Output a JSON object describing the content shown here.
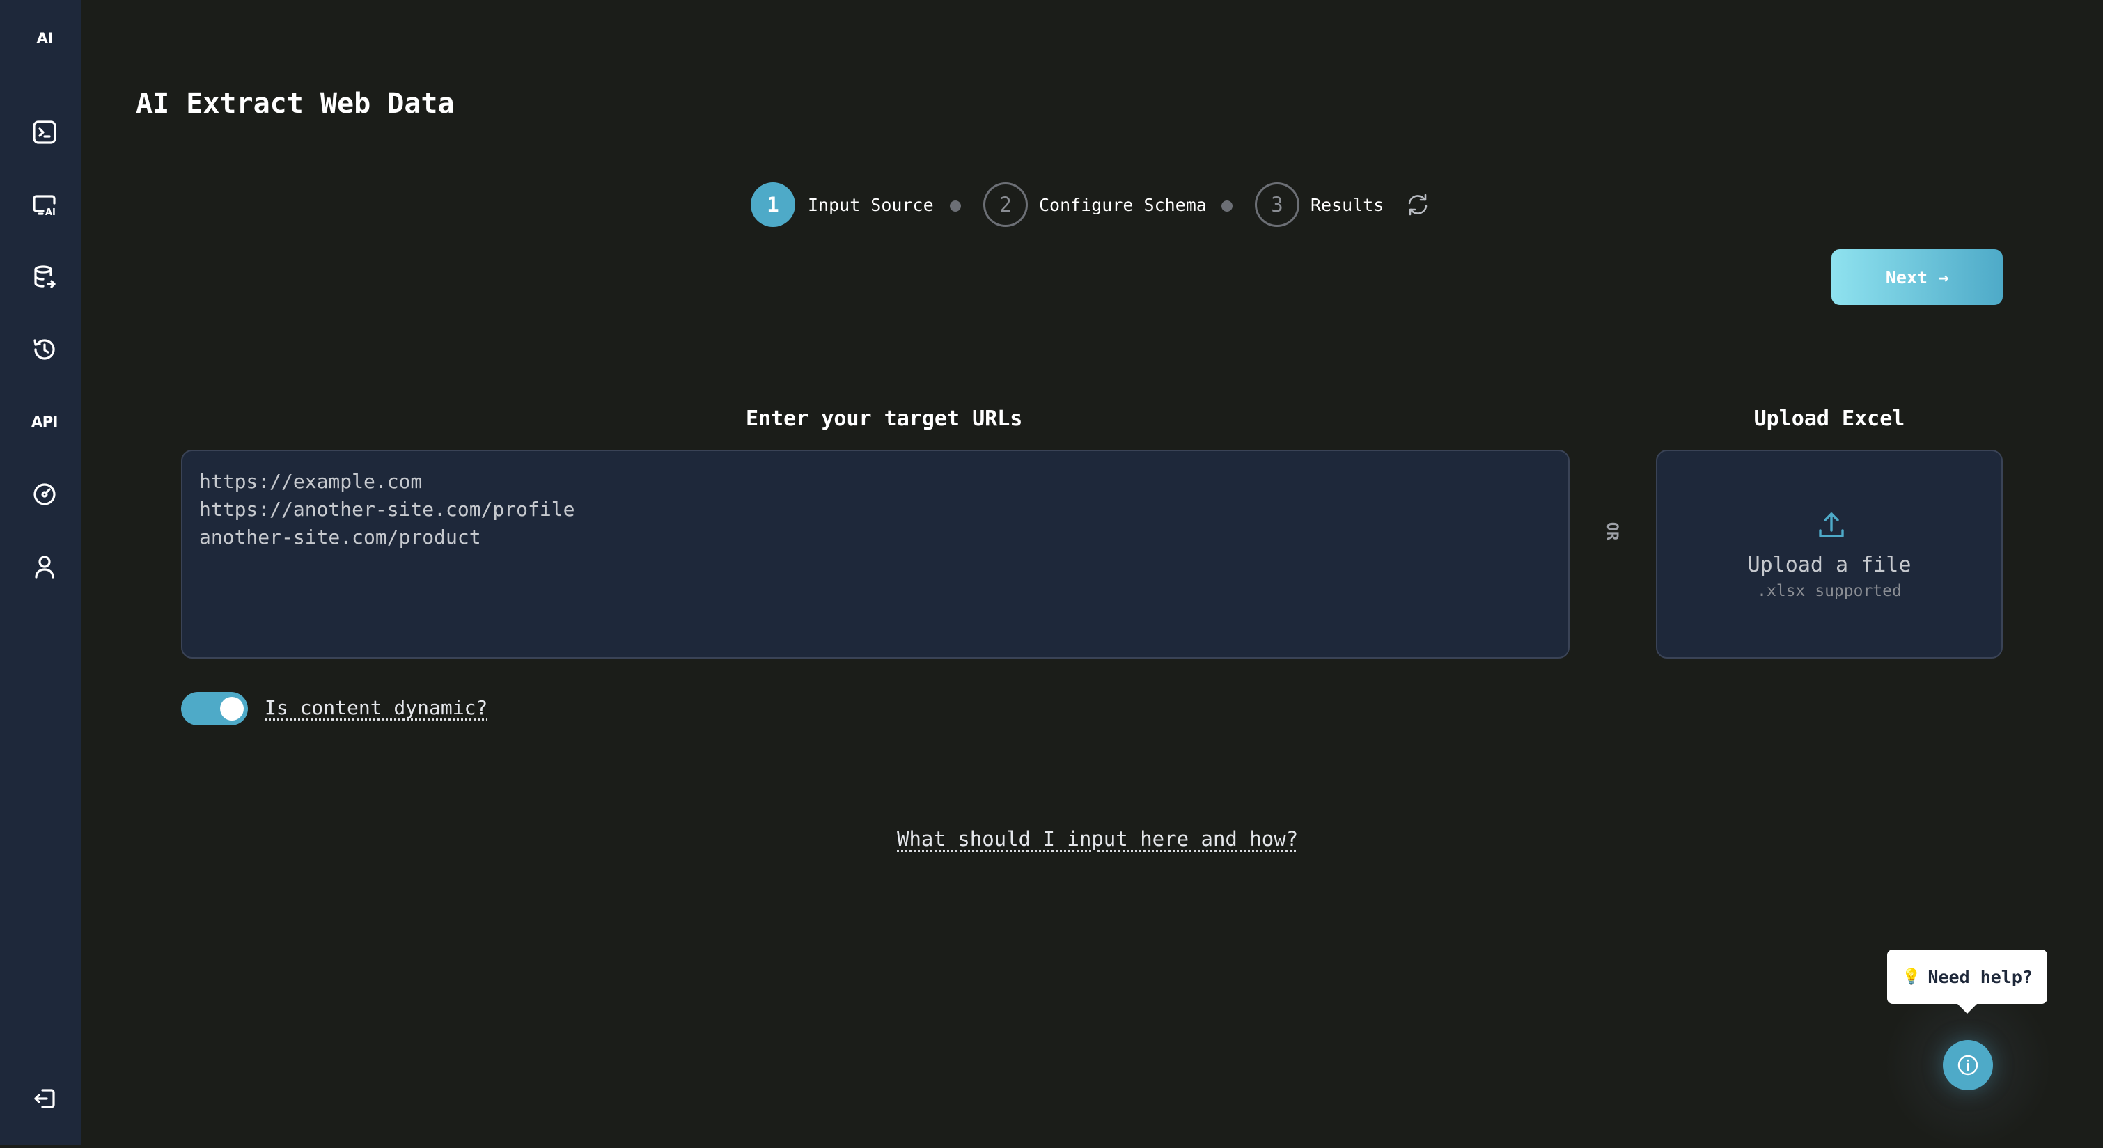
{
  "sidebar": {
    "logo_label": "AI",
    "api_label": "API",
    "items": [
      {
        "icon": "terminal-icon"
      },
      {
        "icon": "ai-screen-icon"
      },
      {
        "icon": "database-export-icon"
      },
      {
        "icon": "history-icon"
      },
      {
        "icon": "api-icon"
      },
      {
        "icon": "gauge-icon"
      },
      {
        "icon": "user-icon"
      }
    ],
    "logout_icon": "logout-icon"
  },
  "page": {
    "title": "AI Extract Web Data"
  },
  "stepper": {
    "steps": [
      {
        "number": "1",
        "label": "Input Source",
        "state": "active"
      },
      {
        "number": "2",
        "label": "Configure Schema",
        "state": "inactive"
      },
      {
        "number": "3",
        "label": "Results",
        "state": "inactive"
      }
    ],
    "reset_icon": "refresh-icon"
  },
  "toolbar": {
    "next_label": "Next →"
  },
  "urls": {
    "heading": "Enter your target URLs",
    "placeholder_lines": [
      "https://example.com",
      "https://another-site.com/profile",
      "another-site.com/product"
    ]
  },
  "divider": {
    "or_label": "OR"
  },
  "upload": {
    "heading": "Upload Excel",
    "title": "Upload a file",
    "hint": ".xlsx supported"
  },
  "dynamic_toggle": {
    "label": "Is content dynamic?",
    "checked": true
  },
  "help": {
    "link_label": "What should I input here and how?",
    "tooltip_label": "Need help?"
  },
  "colors": {
    "accent": "#4eaac8",
    "sidebar_bg": "#1e283a",
    "page_bg": "#1b1d19"
  }
}
